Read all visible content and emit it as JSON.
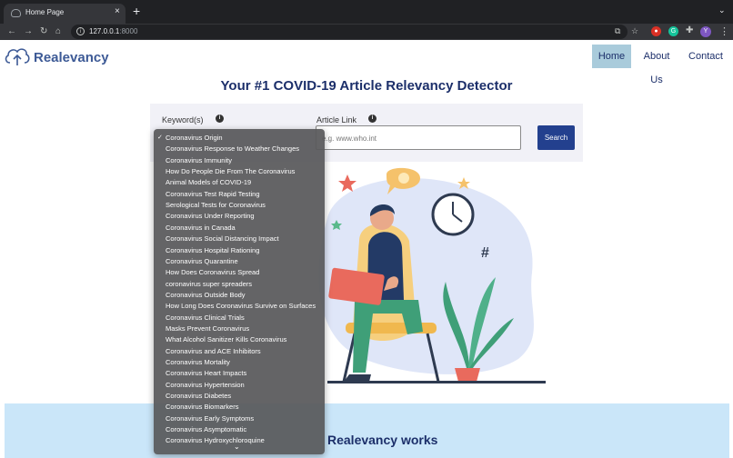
{
  "browser": {
    "tab_title": "Home Page",
    "tab_close": "×",
    "new_tab": "+",
    "url_host": "127.0.0.1",
    "url_port": ":8000"
  },
  "navbar": {
    "brand": "Realevancy",
    "links": [
      "Home",
      "About Us",
      "Contact"
    ],
    "active_link": "Home"
  },
  "hero": {
    "headline": "Your #1 COVID-19 Article Relevancy Detector"
  },
  "search": {
    "keyword_label": "Keyword(s)",
    "link_label": "Article Link",
    "link_placeholder": "e.g. www.who.int",
    "button_label": "Search"
  },
  "dropdown": {
    "selected": "Coronavirus Origin",
    "options": [
      "Coronavirus Origin",
      "Coronavirus Response to Weather Changes",
      "Coronavirus Immunity",
      "How Do People Die From The Coronavirus",
      "Animal Models of COVID-19",
      "Coronavirus Test Rapid Testing",
      "Serological Tests for Coronavirus",
      "Coronavirus Under Reporting",
      "Coronavirus in Canada",
      "Coronavirus Social Distancing Impact",
      "Coronavirus Hospital Rationing",
      "Coronavirus Quarantine",
      "How Does Coronavirus Spread",
      "coronavirus super spreaders",
      "Coronavirus Outside Body",
      "How Long Does Coronavirus Survive on Surfaces",
      "Coronavirus Clinical Trials",
      "Masks Prevent Coronavirus",
      "What Alcohol Sanitizer Kills Coronavirus",
      "Coronavirus and ACE Inhibitors",
      "Coronavirus Mortality",
      "Coronavirus Heart Impacts",
      "Coronavirus Hypertension",
      "Coronavirus Diabetes",
      "Coronavirus Biomarkers",
      "Coronavirus Early Symptoms",
      "Coronavirus Asymptomatic",
      "Coronavirus Hydroxychloroquine"
    ]
  },
  "section": {
    "works_text": "Realevancy works"
  },
  "colors": {
    "brand": "#3d5a96",
    "navy": "#1c2f6a",
    "button": "#23408e",
    "active_nav": "#a9cbdb",
    "band": "#cae6f9"
  }
}
